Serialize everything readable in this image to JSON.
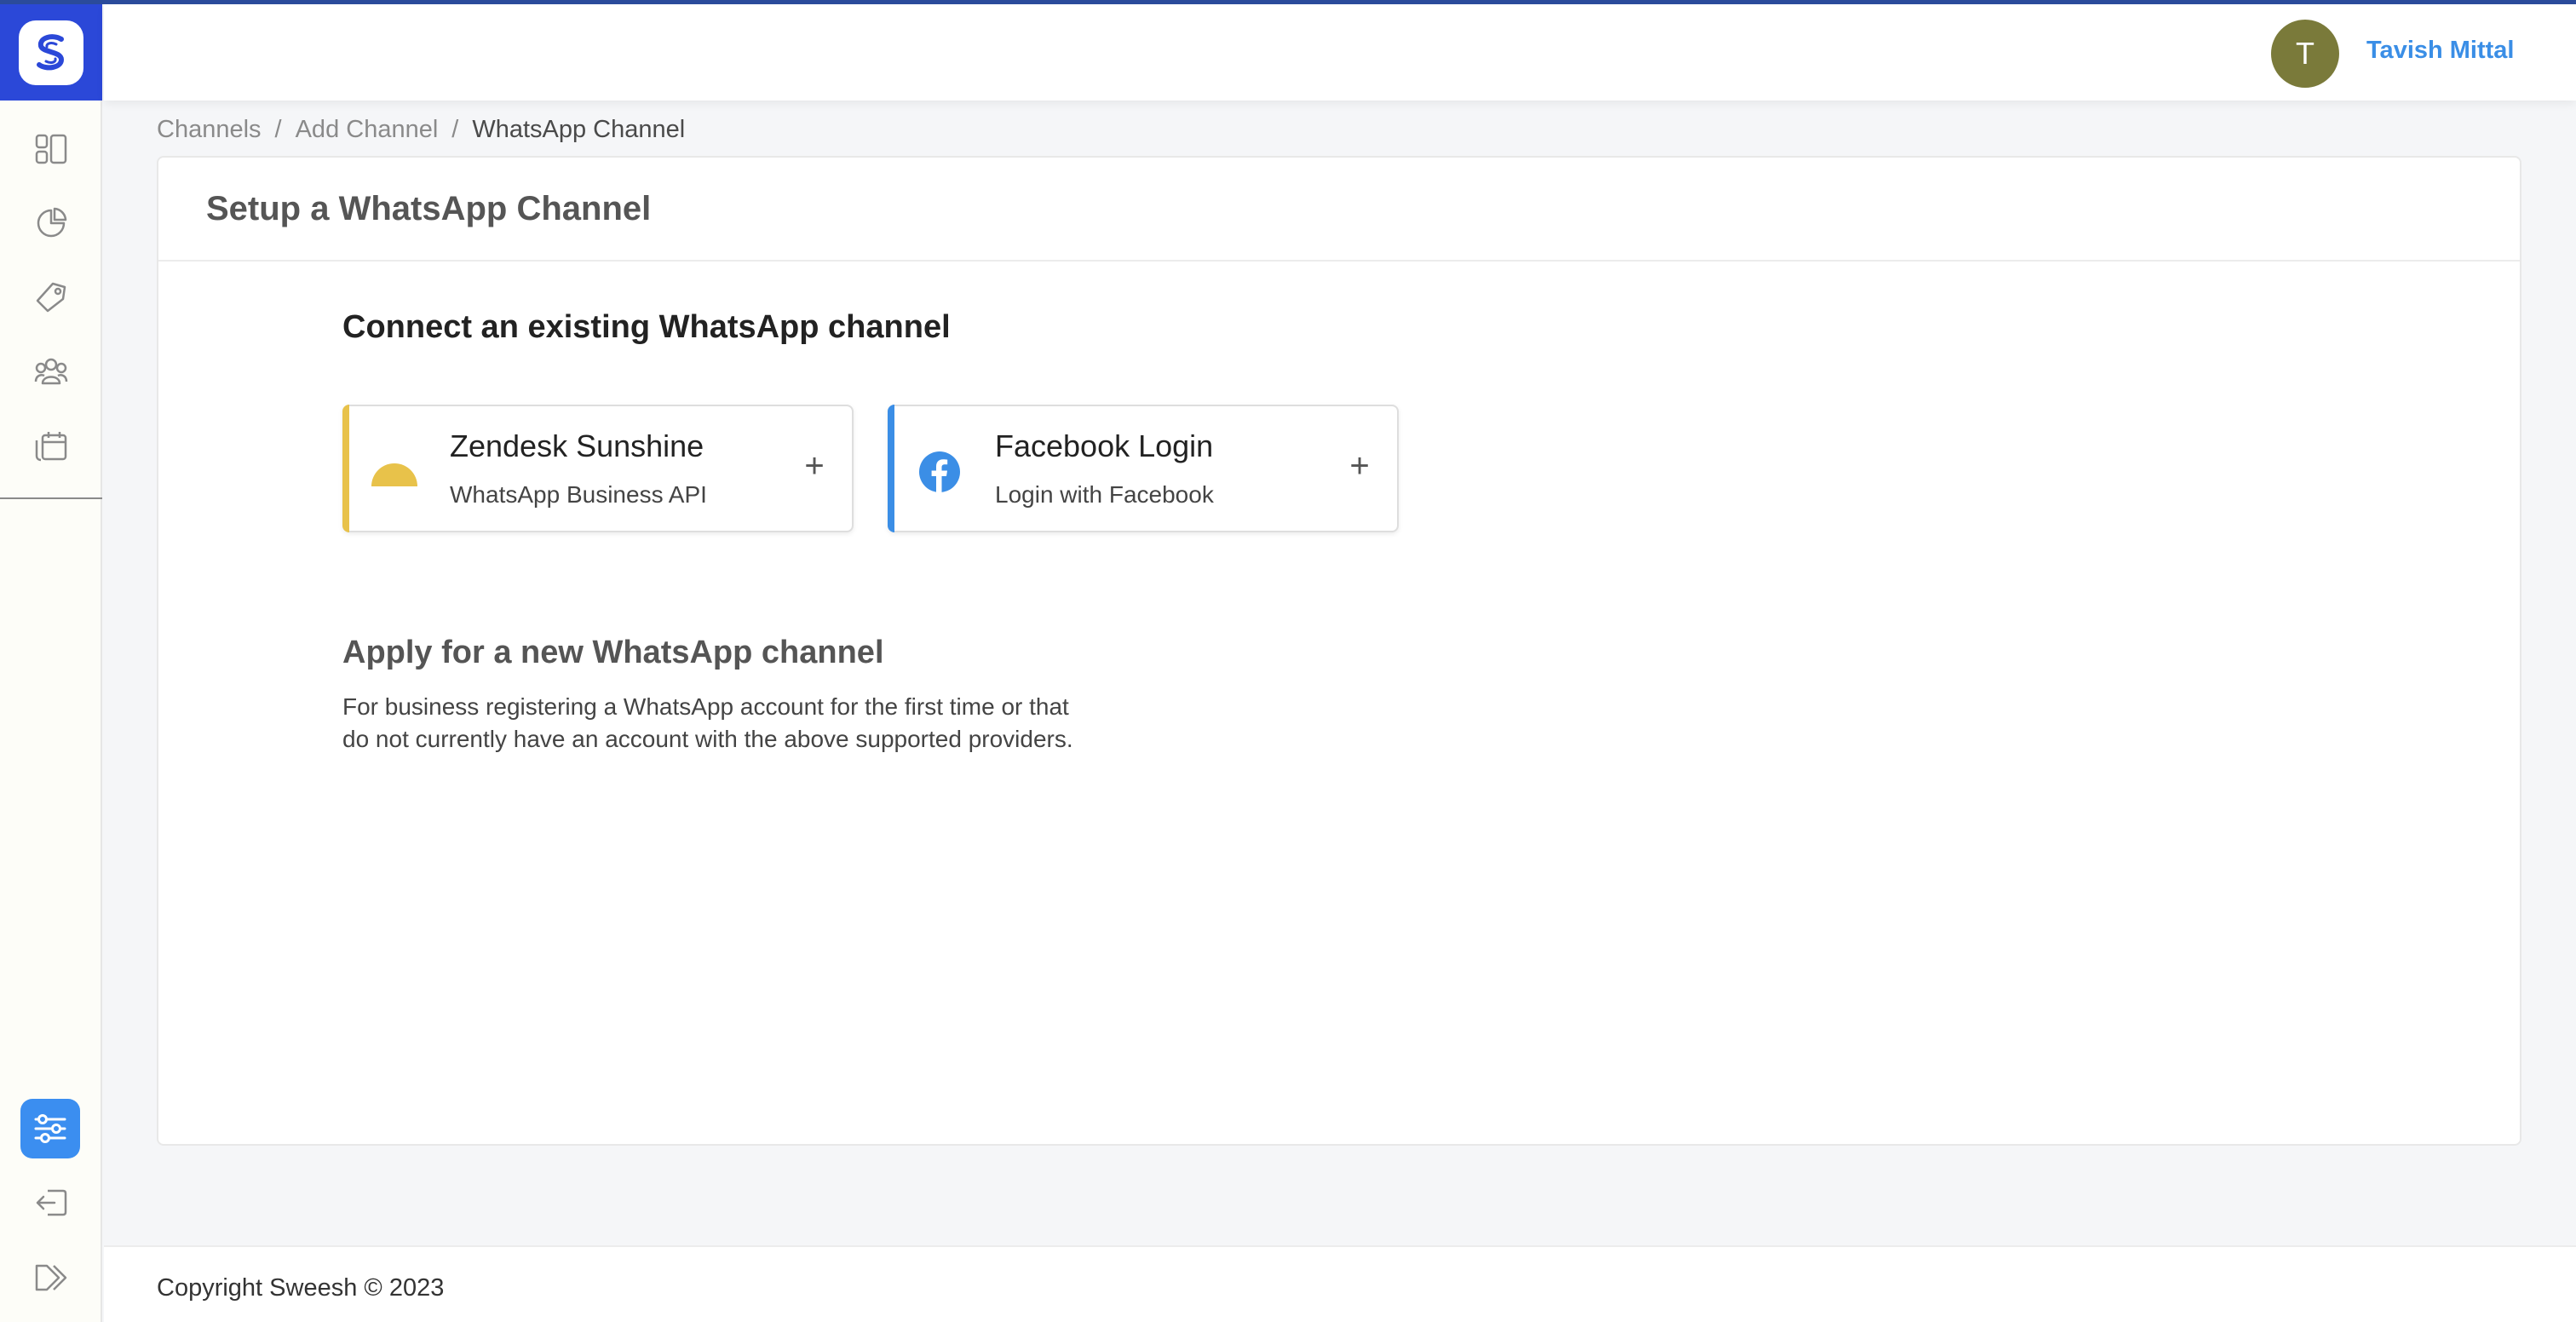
{
  "app": {
    "brand_color": "#2b48d8",
    "accent_color": "#3b8ef0"
  },
  "sidebar": {
    "items": [
      {
        "icon": "dashboard-icon"
      },
      {
        "icon": "analytics-pie-icon"
      },
      {
        "icon": "campaign-tag-icon"
      },
      {
        "icon": "contacts-group-icon"
      },
      {
        "icon": "calendar-schedule-icon"
      }
    ],
    "bottom": [
      {
        "icon": "settings-sliders-icon",
        "active": true
      },
      {
        "icon": "logout-icon"
      },
      {
        "icon": "expand-sidebar-icon"
      }
    ]
  },
  "header": {
    "avatar_initial": "T",
    "user_name": "Tavish Mittal"
  },
  "breadcrumb": {
    "items": [
      "Channels",
      "Add Channel",
      "WhatsApp Channel"
    ],
    "separator": "/"
  },
  "card": {
    "title": "Setup a WhatsApp Channel",
    "connect_title": "Connect an existing WhatsApp channel",
    "providers": [
      {
        "name": "Zendesk Sunshine",
        "subtitle": "WhatsApp Business API",
        "icon": "zendesk-sunshine-icon",
        "accent": "#e8c24a",
        "action": "+"
      },
      {
        "name": "Facebook Login",
        "subtitle": "Login with Facebook",
        "icon": "facebook-icon",
        "accent": "#3b8ee6",
        "action": "+"
      }
    ],
    "apply_title": "Apply for a new WhatsApp channel",
    "apply_desc_line1": "For business registering a WhatsApp account for the first time or that",
    "apply_desc_line2": "do not currently have an account with the above supported providers."
  },
  "footer": {
    "copyright": "Copyright Sweesh © 2023"
  }
}
